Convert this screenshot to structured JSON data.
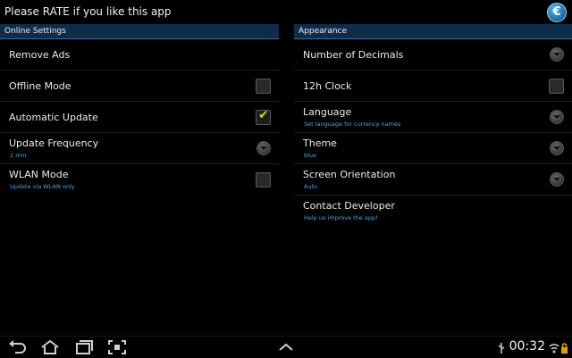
{
  "app": {
    "title": "Please RATE if you like this app",
    "logo": "€"
  },
  "left": {
    "header": "Online Settings",
    "items": [
      {
        "label": "Remove Ads",
        "sub": "",
        "control": "none"
      },
      {
        "label": "Offline Mode",
        "sub": "",
        "control": "checkbox",
        "checked": false
      },
      {
        "label": "Automatic Update",
        "sub": "",
        "control": "checkbox",
        "checked": true
      },
      {
        "label": "Update Frequency",
        "sub": "2 min",
        "control": "dropdown"
      },
      {
        "label": "WLAN Mode",
        "sub": "Update via WLAN only",
        "control": "checkbox",
        "checked": false
      }
    ]
  },
  "right": {
    "header": "Appearance",
    "items": [
      {
        "label": "Number of Decimals",
        "sub": "",
        "control": "dropdown"
      },
      {
        "label": "12h Clock",
        "sub": "",
        "control": "checkbox",
        "checked": false
      },
      {
        "label": "Language",
        "sub": "Set language for currency names",
        "control": "dropdown"
      },
      {
        "label": "Theme",
        "sub": "blue",
        "control": "dropdown"
      },
      {
        "label": "Screen Orientation",
        "sub": "Auto",
        "control": "dropdown"
      },
      {
        "label": "Contact Developer",
        "sub": "Help us improve the app!",
        "control": "none"
      }
    ]
  },
  "statusbar": {
    "time": "00:32",
    "icons": [
      "back-icon",
      "home-icon",
      "recent-apps-icon",
      "screenshot-icon",
      "chevron-up-icon",
      "usb-icon",
      "wifi-icon",
      "lock-icon"
    ]
  },
  "colors": {
    "accent": "#2a6fa8",
    "subtext": "#4aa8e0",
    "check": "#b4e000"
  }
}
